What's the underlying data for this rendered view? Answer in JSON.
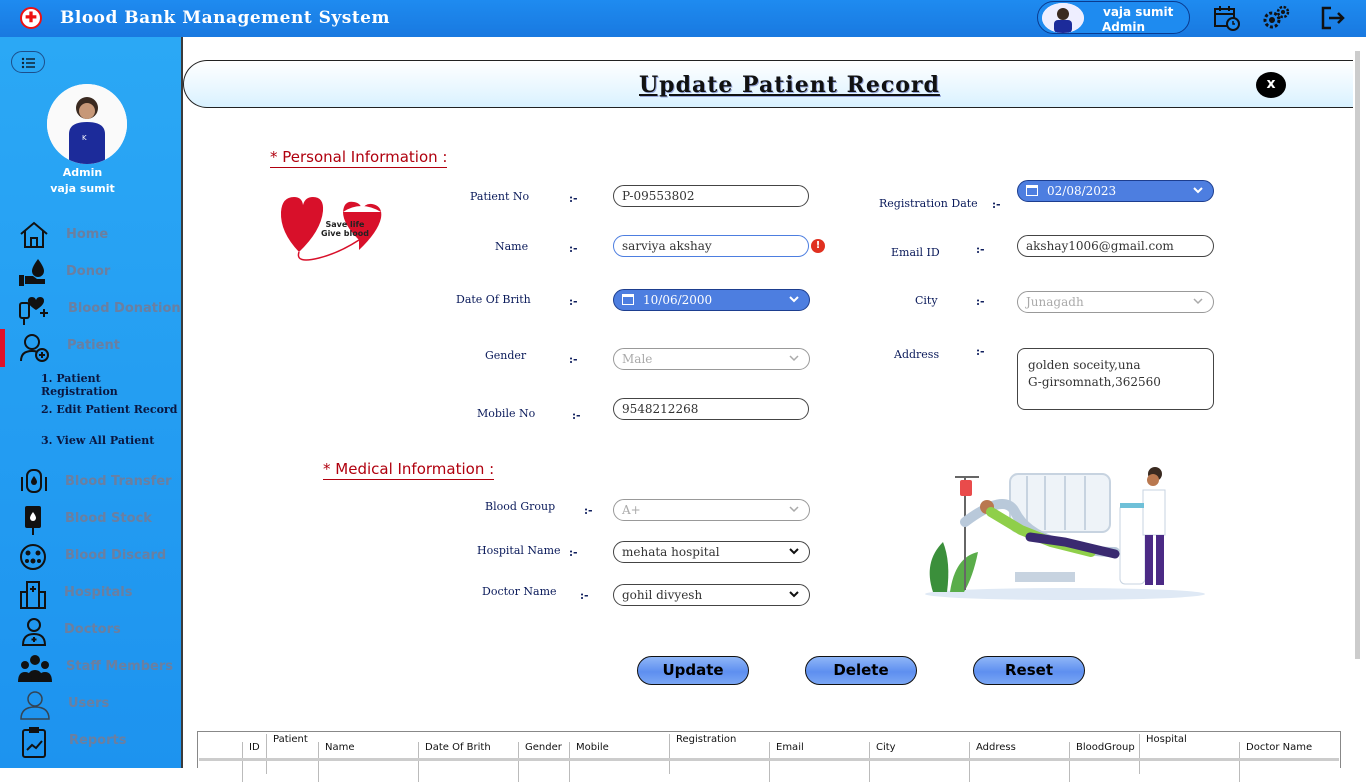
{
  "app": {
    "title": "Blood Bank Management System"
  },
  "user": {
    "name": "vaja sumit",
    "role": "Admin"
  },
  "sidebar": {
    "profile_role": "Admin",
    "profile_name": "vaja sumit",
    "items": [
      {
        "label": "Home"
      },
      {
        "label": "Donor"
      },
      {
        "label": "Blood Donation"
      },
      {
        "label": "Patient"
      },
      {
        "label": "Blood Transfer"
      },
      {
        "label": "Blood Stock"
      },
      {
        "label": "Blood Discard"
      },
      {
        "label": "Hospitals"
      },
      {
        "label": "Doctors"
      },
      {
        "label": "Staff Members"
      },
      {
        "label": "Users"
      },
      {
        "label": "Reports"
      }
    ],
    "subitems": [
      {
        "label": "1.  Patient Registration"
      },
      {
        "label": "2.  Edit Patient Record"
      },
      {
        "label": "3.  View All Patient"
      }
    ]
  },
  "page": {
    "title": "Update Patient Record",
    "close": "x"
  },
  "personal": {
    "title": "*  Personal Information  :",
    "logo_line1": "Save life",
    "logo_line2": "Give blood",
    "patient_no": {
      "label": "Patient No",
      "value": "P-09553802"
    },
    "name": {
      "label": "Name",
      "value": "sarviya akshay"
    },
    "dob": {
      "label": "Date Of Brith",
      "value": "10/06/2000"
    },
    "gender": {
      "label": "Gender",
      "value": "Male"
    },
    "mobile": {
      "label": "Mobile No",
      "value": "9548212268"
    },
    "reg_date": {
      "label": "Registration Date",
      "value": "02/08/2023"
    },
    "email": {
      "label": "Email ID",
      "value": "akshay1006@gmail.com"
    },
    "city": {
      "label": "City",
      "value": "Junagadh"
    },
    "address": {
      "label": "Address",
      "line1": "golden soceity,una",
      "line2": "G-girsomnath,362560"
    },
    "separator": ":-"
  },
  "medical": {
    "title": "*  Medical Information  :",
    "blood_group": {
      "label": "Blood Group",
      "value": "A+"
    },
    "hospital": {
      "label": "Hospital Name",
      "value": "mehata hospital"
    },
    "doctor": {
      "label": "Doctor Name",
      "value": "gohil divyesh"
    }
  },
  "actions": {
    "update": "Update",
    "delete": "Delete",
    "reset": "Reset"
  },
  "grid": {
    "columns": [
      "ID",
      "Patient",
      "Name",
      "Date Of Brith",
      "Gender",
      "Mobile",
      "Registration",
      "Email",
      "City",
      "Address",
      "BloodGroup",
      "Hospital",
      "Doctor Name"
    ]
  },
  "colors": {
    "accent": "#1e8bf0",
    "active": "#e0102a",
    "section": "#b0000e",
    "date_field": "#4d7ee0"
  }
}
